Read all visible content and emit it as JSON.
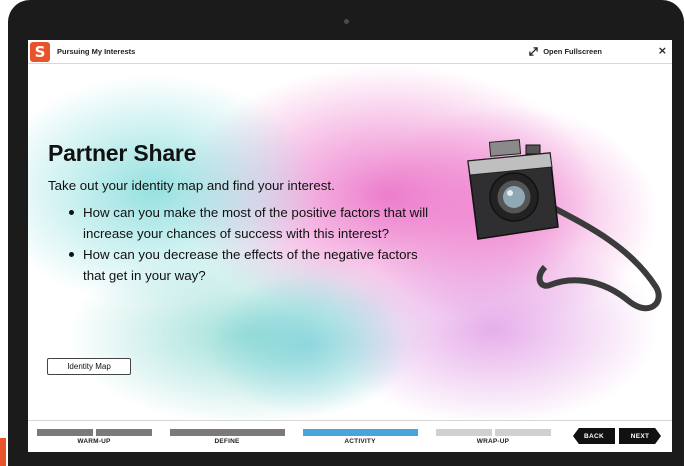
{
  "app": {
    "logo": "S",
    "title": "Pursuing My Interests",
    "fullscreen_label": "Open Fullscreen",
    "close_glyph": "×"
  },
  "slide": {
    "heading": "Partner Share",
    "intro": "Take out your identity map and find your interest.",
    "bullets": [
      "How can you make the most of the positive factors that will increase your chances of success with this interest?",
      "How can you decrease the effects of the negative factors that get in your way?"
    ],
    "button_label": "Identity Map"
  },
  "nav": {
    "stages": [
      {
        "label": "WARM-UP",
        "status": "complete"
      },
      {
        "label": "DEFINE",
        "status": "complete"
      },
      {
        "label": "ACTIVITY",
        "status": "current"
      },
      {
        "label": "WRAP-UP",
        "status": "upcoming"
      }
    ],
    "back_label": "BACK",
    "next_label": "NEXT"
  },
  "colors": {
    "brand": "#e8532b",
    "stage_complete": "#7a7a7a",
    "stage_current": "#49a3dd",
    "stage_upcoming": "#d0d0d0",
    "watercolor_pink": "#e96fc4",
    "watercolor_teal": "#6fd3cf"
  },
  "icons": {
    "logo": "brand-logo-icon",
    "fullscreen": "expand-arrows-icon",
    "close": "close-icon",
    "illustration": "camera-illustration"
  }
}
